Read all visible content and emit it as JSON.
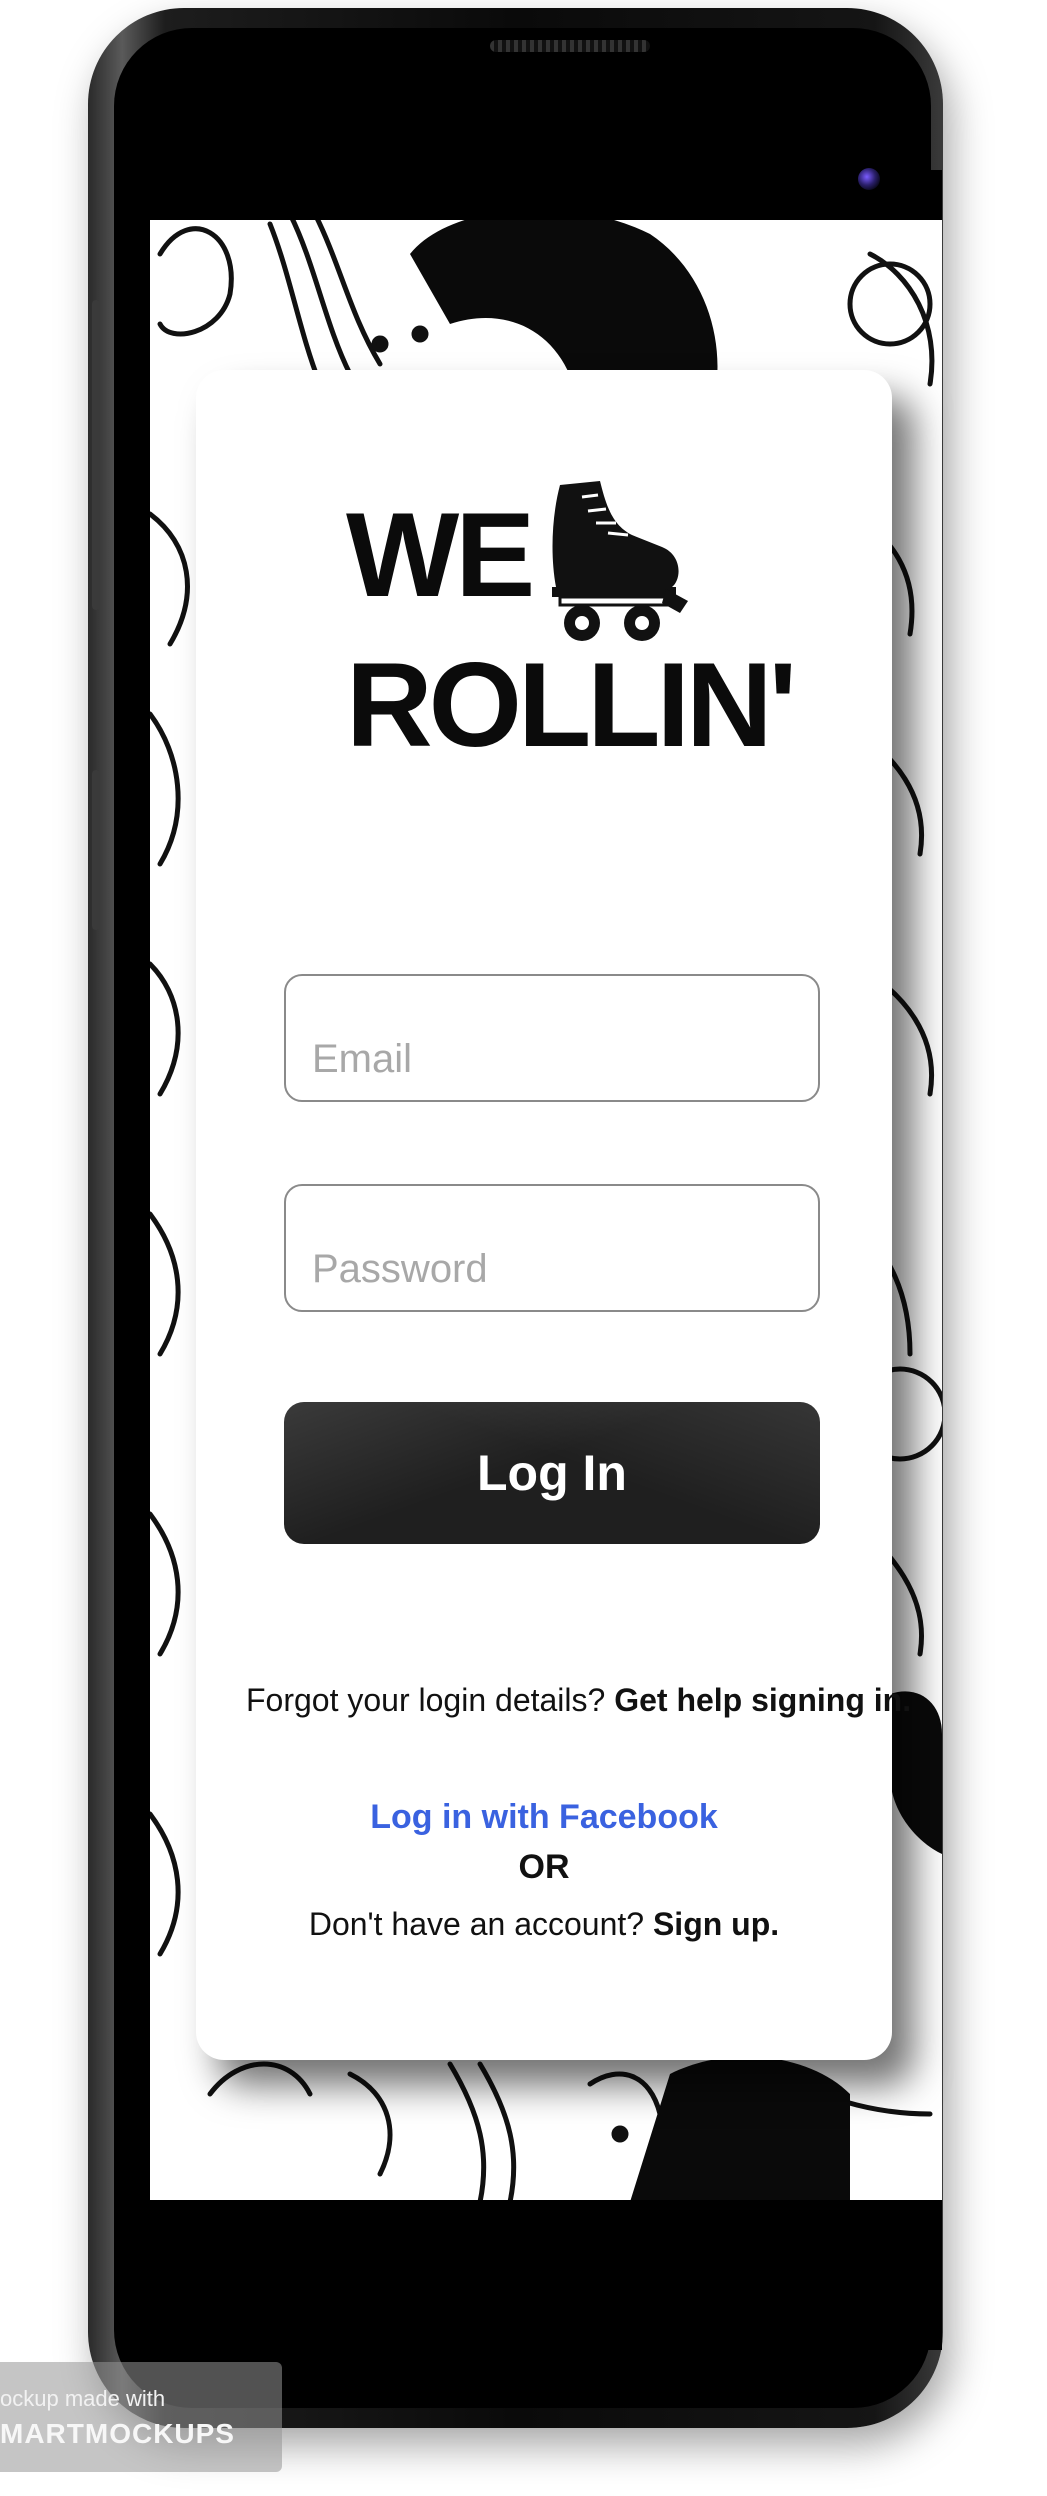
{
  "app": {
    "logo_line1": "WE",
    "logo_line2": "ROLLIN'",
    "logo_icon": "roller-skate-icon"
  },
  "form": {
    "email_placeholder": "Email",
    "password_placeholder": "Password",
    "login_label": "Log In"
  },
  "links": {
    "forgot_text": "Forgot your login details? ",
    "get_help_label": "Get help signing in.",
    "facebook_label": "Log in with Facebook",
    "or_text": "OR",
    "no_account_text": "Don't have an account? ",
    "signup_label": "Sign up."
  },
  "watermark": {
    "line1": "ockup made with",
    "line2": "MARTMOCKUPS"
  },
  "colors": {
    "button_bg": "#1f1f1f",
    "link_blue": "#3a62e0",
    "placeholder": "#a8a8a8"
  }
}
